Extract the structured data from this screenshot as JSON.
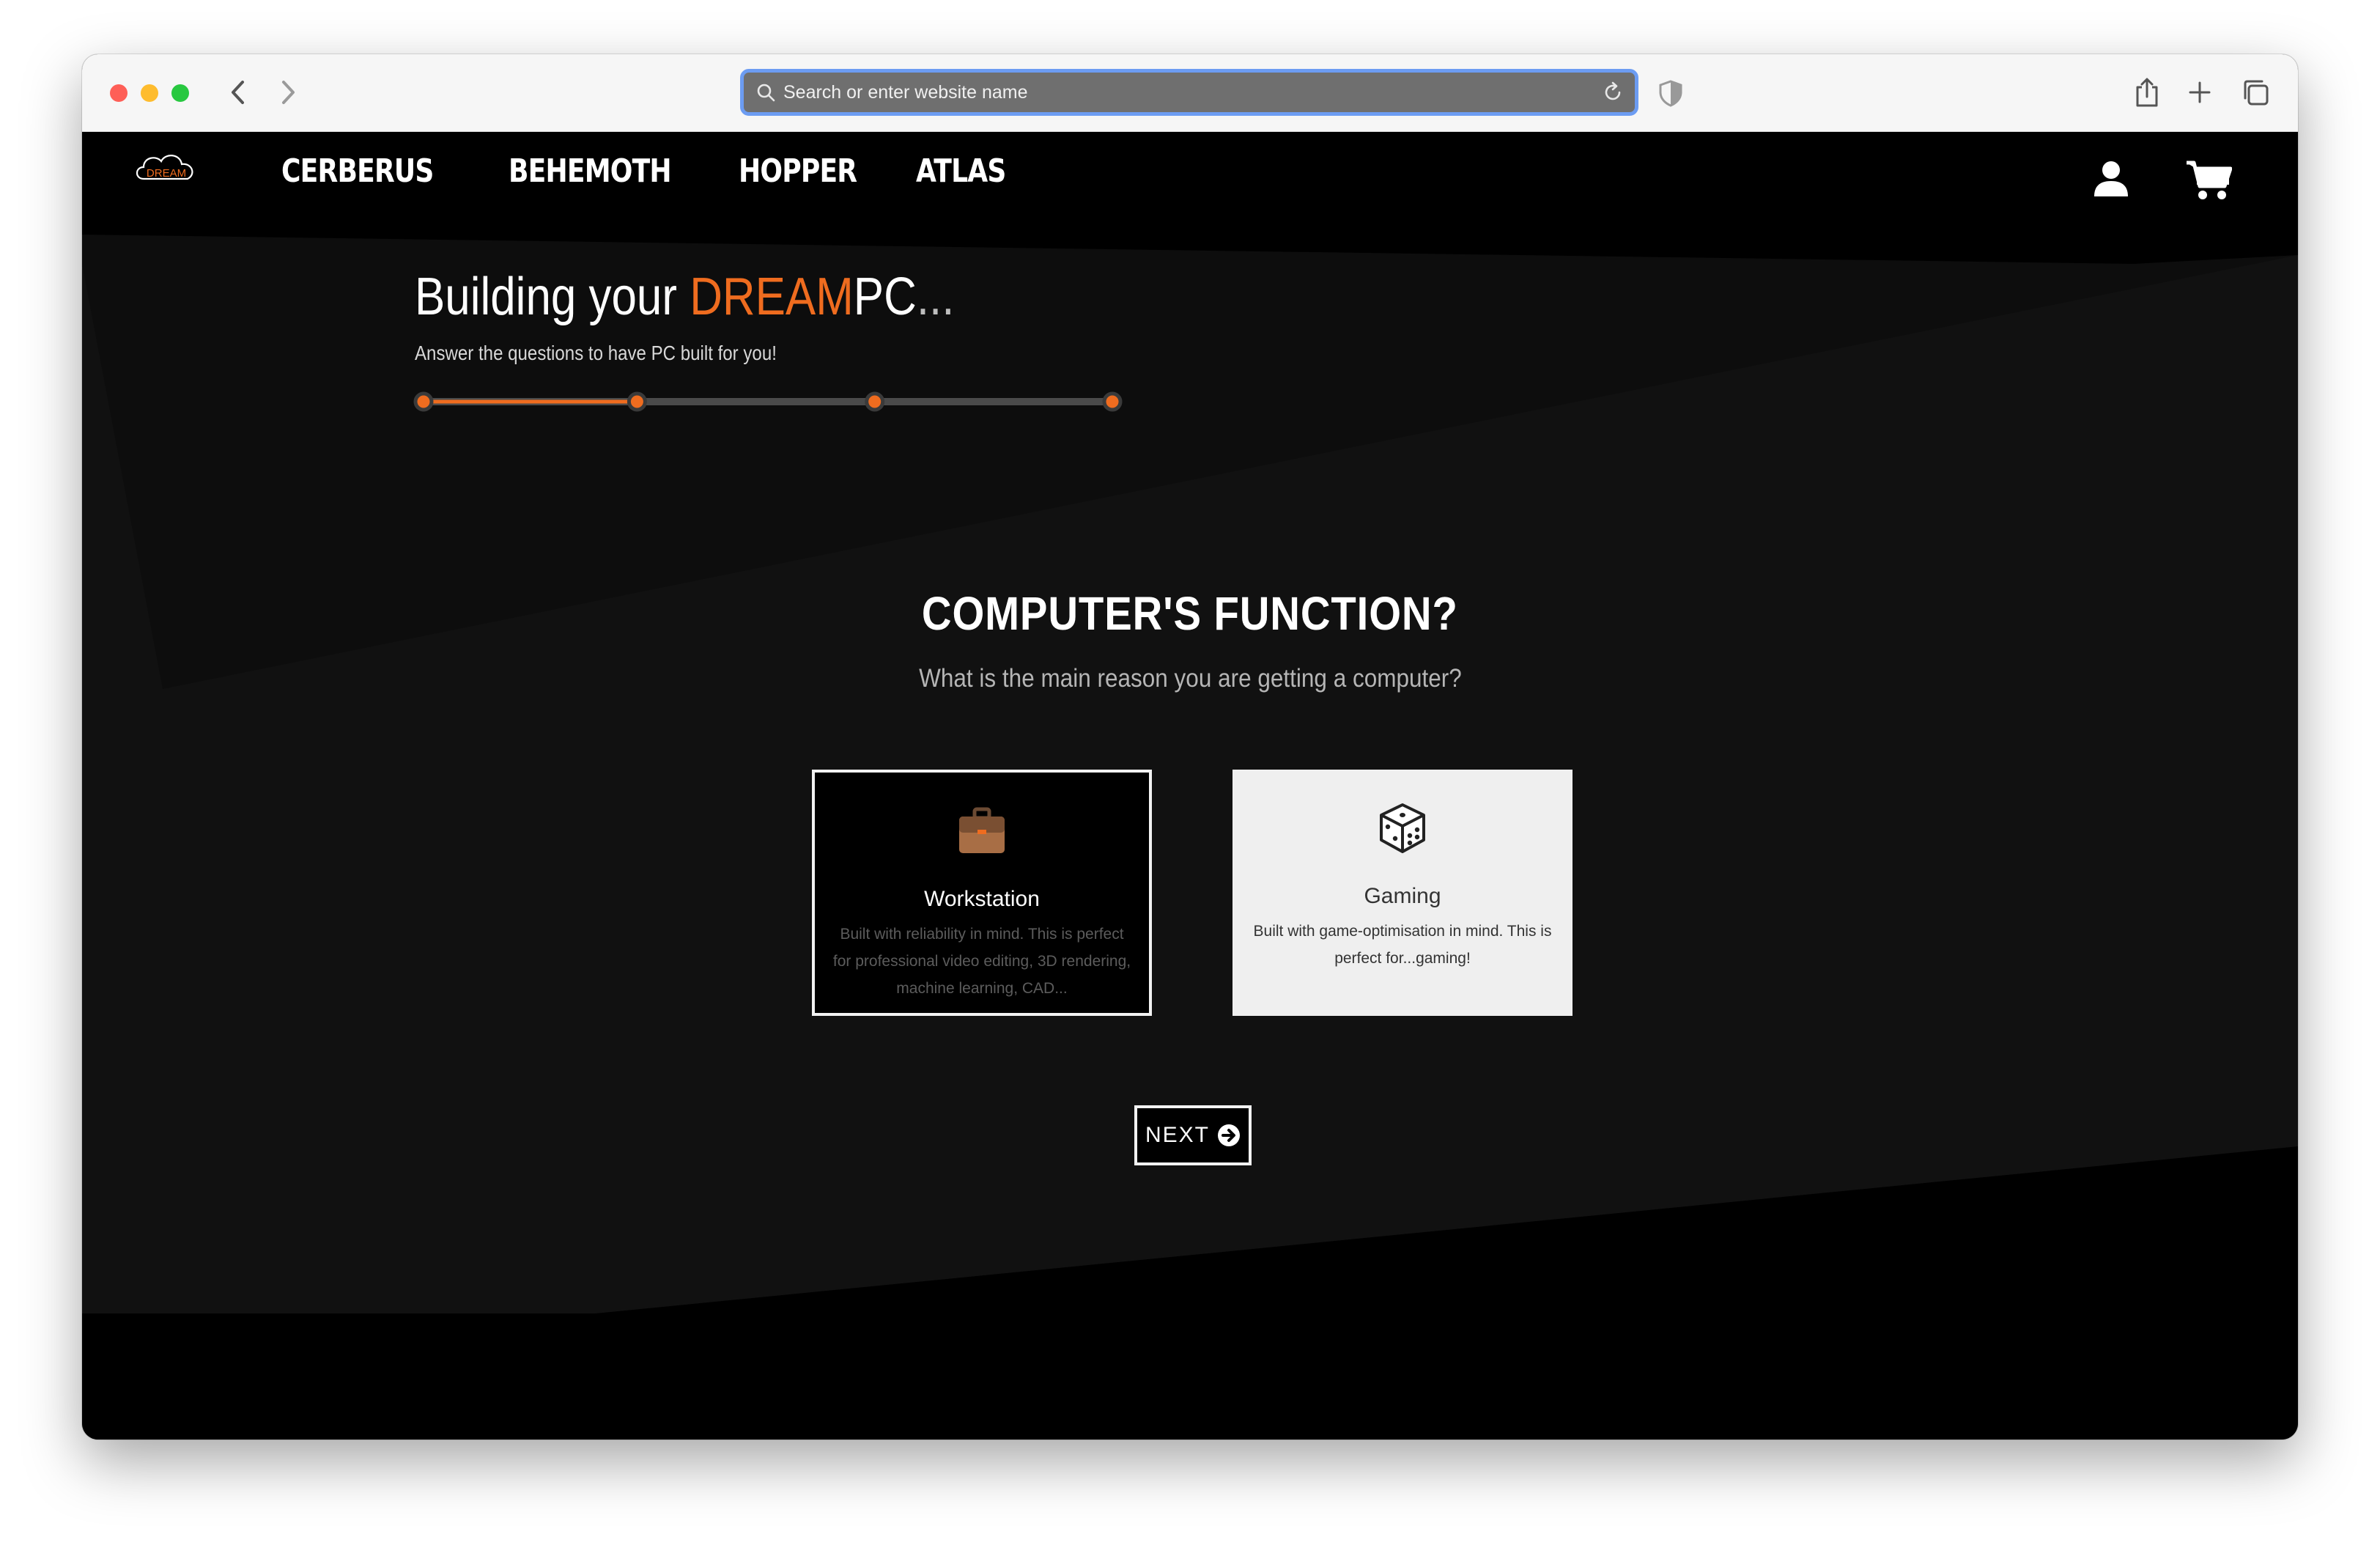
{
  "browser": {
    "url_placeholder": "Search or enter website name"
  },
  "nav": {
    "logo_text": "DREAM",
    "links": [
      "CERBERUS",
      "BEHEMOTH",
      "HOPPER",
      "ATLAS"
    ]
  },
  "hero": {
    "title_prefix": "Building your ",
    "title_brand": "DREAM",
    "title_suffix": "PC",
    "title_dots": "...",
    "subtitle": "Answer the questions to have PC built for you!",
    "progress": {
      "total_steps": 4,
      "completed_fraction": 0.31
    }
  },
  "question": {
    "title": "COMPUTER'S FUNCTION?",
    "subtitle": "What is the main reason you are getting a computer?"
  },
  "options": [
    {
      "title": "Workstation",
      "description": "Built with reliability in mind. This is perfect for professional video editing, 3D rendering, machine learning, CAD...",
      "icon": "briefcase-icon",
      "selected": true
    },
    {
      "title": "Gaming",
      "description": "Built with game-optimisation in mind. This is perfect for...gaming!",
      "icon": "dice-icon",
      "selected": false
    }
  ],
  "next_button": {
    "label": "NEXT"
  },
  "colors": {
    "accent": "#ef6c1f",
    "background": "#000000",
    "panel": "#111111"
  }
}
